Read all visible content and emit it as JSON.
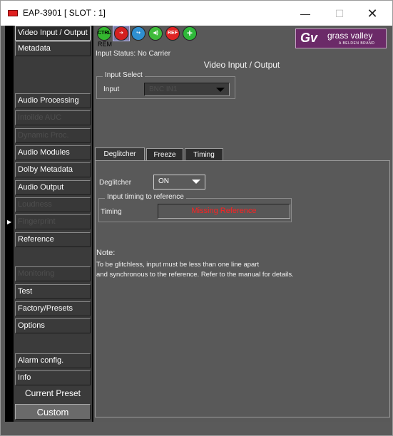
{
  "window": {
    "title": "EAP-3901 [ SLOT : 1]",
    "min_glyph": "—",
    "max_glyph": "☐",
    "close_glyph": "✕"
  },
  "sidebar": {
    "items": [
      {
        "label": "Video Input / Output",
        "state": "active"
      },
      {
        "label": "Metadata",
        "state": "normal"
      },
      {
        "label": "Audio Processing",
        "state": "normal"
      },
      {
        "label": "Intoilde AUC",
        "state": "disabled"
      },
      {
        "label": "Dynamic Proc.",
        "state": "disabled"
      },
      {
        "label": "Audio Modules",
        "state": "normal"
      },
      {
        "label": "Dolby Metadata",
        "state": "normal"
      },
      {
        "label": "Audio Output",
        "state": "normal"
      },
      {
        "label": "Loudness",
        "state": "disabled"
      },
      {
        "label": "Fingerprint",
        "state": "disabled"
      },
      {
        "label": "Reference",
        "state": "normal"
      },
      {
        "label": "Monitoring",
        "state": "disabled"
      },
      {
        "label": "Test",
        "state": "normal"
      },
      {
        "label": "Factory/Presets",
        "state": "normal"
      },
      {
        "label": "Options",
        "state": "normal"
      },
      {
        "label": "Alarm config.",
        "state": "normal"
      },
      {
        "label": "Info",
        "state": "normal"
      }
    ],
    "preset_label": "Current Preset",
    "preset_value": "Custom"
  },
  "toolbar": {
    "icons": [
      {
        "name": "ctrl-icon",
        "text": "CTRL"
      },
      {
        "name": "next-arrow-icon",
        "text": "➔"
      },
      {
        "name": "move-icon",
        "text": "↪"
      },
      {
        "name": "audio-icon",
        "text": "◀)"
      },
      {
        "name": "ref-icon",
        "text": "REF"
      },
      {
        "name": "add-icon",
        "text": "+"
      }
    ],
    "rem_label": "REM"
  },
  "logo": {
    "mark": "Gv",
    "brand": "grass valley",
    "sub": "A BELDEN BRAND"
  },
  "content": {
    "input_status": "Input Status: No Carrier",
    "page_title": "Video Input / Output",
    "input_select": {
      "legend": "Input Select",
      "label": "Input",
      "value": "BNC IN1"
    },
    "tabs": [
      "Deglitcher",
      "Freeze",
      "Timing"
    ],
    "active_tab": "Deglitcher",
    "deglitcher": {
      "label": "Deglitcher",
      "value": "ON"
    },
    "timing_group": {
      "legend": "Input timing to reference",
      "label": "Timing",
      "status": "Missing Reference"
    },
    "note": {
      "title": "Note:",
      "lines": [
        "To be glitchless, input must be less than one line apart",
        "and synchronous to the reference. Refer to the manual for details."
      ]
    }
  },
  "colors": {
    "panel_bg": "#595959",
    "sidebar_bg": "#3b3b3b",
    "alert_text": "#ff2020",
    "logo_bg": "#6b2a68"
  }
}
